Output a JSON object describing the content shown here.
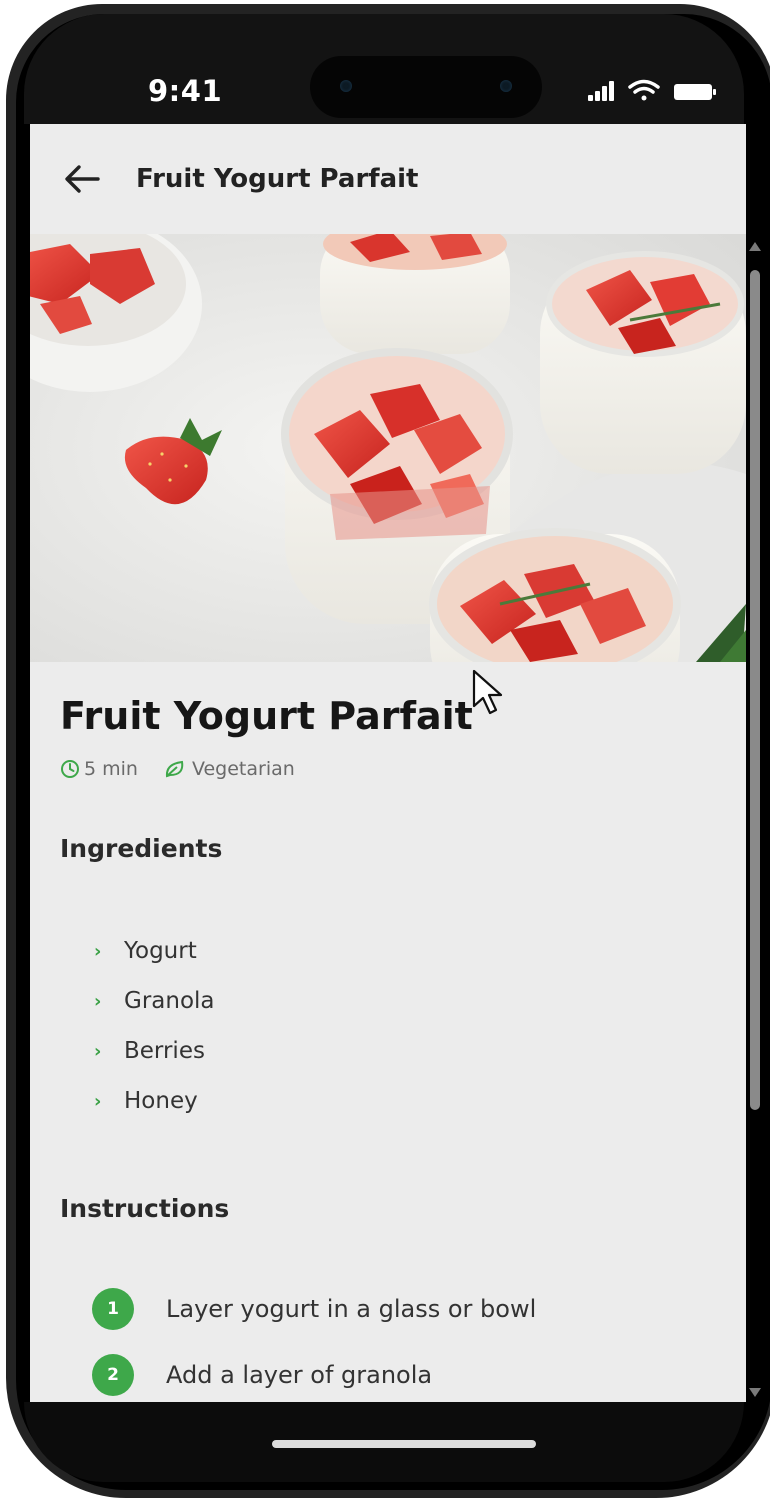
{
  "status_bar": {
    "time": "9:41",
    "icons": [
      "signal-icon",
      "wifi-icon",
      "battery-icon"
    ]
  },
  "app_bar": {
    "back_icon": "back-arrow-icon",
    "title": "Fruit Yogurt Parfait"
  },
  "recipe": {
    "title": "Fruit Yogurt Parfait",
    "time_icon": "clock-icon",
    "time": "5 min",
    "diet_icon": "leaf-icon",
    "diet": "Vegetarian",
    "ingredients_heading": "Ingredients",
    "ingredients": [
      {
        "label": "Yogurt"
      },
      {
        "label": "Granola"
      },
      {
        "label": "Berries"
      },
      {
        "label": "Honey"
      }
    ],
    "instructions_heading": "Instructions",
    "steps": [
      {
        "number": "1",
        "text": "Layer yogurt in a glass or bowl"
      },
      {
        "number": "2",
        "text": "Add a layer of granola"
      }
    ]
  },
  "colors": {
    "accent_green": "#3ea84a",
    "screen_background": "#ececec",
    "text_primary": "#161616",
    "text_muted": "#6a6a6a"
  }
}
